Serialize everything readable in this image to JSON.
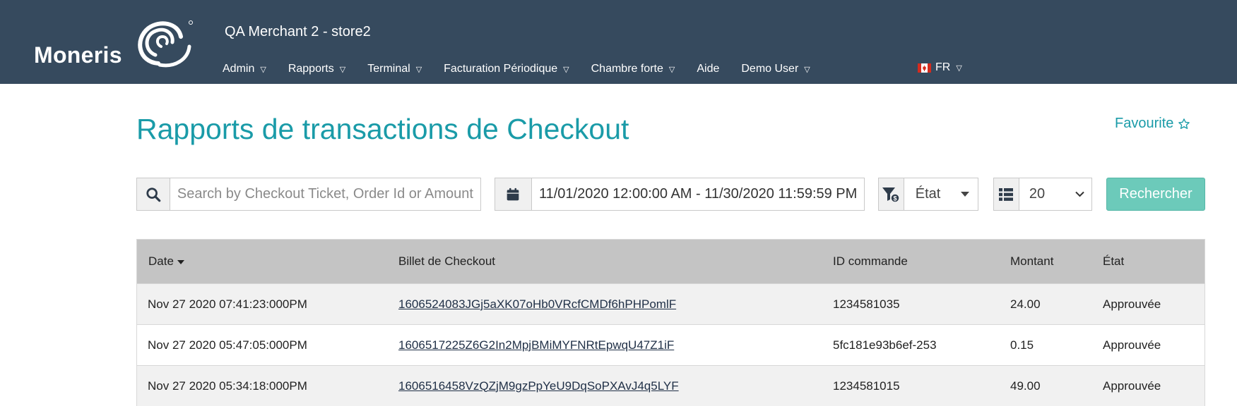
{
  "header": {
    "logo_text": "Moneris",
    "merchant": "QA Merchant 2 - store2",
    "nav": [
      {
        "label": "Admin",
        "has_dropdown": true
      },
      {
        "label": "Rapports",
        "has_dropdown": true
      },
      {
        "label": "Terminal",
        "has_dropdown": true
      },
      {
        "label": "Facturation Périodique",
        "has_dropdown": true
      },
      {
        "label": "Chambre forte",
        "has_dropdown": true
      },
      {
        "label": "Aide",
        "has_dropdown": false
      },
      {
        "label": "Demo User",
        "has_dropdown": true
      }
    ],
    "language": "FR",
    "colors": {
      "bar": "#364a5e",
      "accent": "#1a9ba8",
      "button": "#6ccaba"
    }
  },
  "page": {
    "title": "Rapports de transactions de Checkout",
    "favourite_label": "Favourite"
  },
  "toolbar": {
    "search_placeholder": "Search by Checkout Ticket, Order Id or Amount",
    "search_value": "",
    "date_range": "11/01/2020 12:00:00 AM - 11/30/2020 11:59:59 PM",
    "status_filter_label": "État",
    "page_size": "20",
    "search_button": "Rechercher"
  },
  "table": {
    "columns": [
      "Date",
      "Billet de Checkout",
      "ID commande",
      "Montant",
      "État"
    ],
    "sorted_column": "Date",
    "sort_direction": "descending",
    "rows": [
      {
        "date": "Nov 27 2020 07:41:23:000PM",
        "ticket": "1606524083JGj5aXK07oHb0VRcfCMDf6hPHPomlF",
        "order_id": "1234581035",
        "amount": "24.00",
        "status": "Approuvée"
      },
      {
        "date": "Nov 27 2020 05:47:05:000PM",
        "ticket": "1606517225Z6G2In2MpjBMiMYFNRtEpwqU47Z1iF",
        "order_id": "5fc181e93b6ef-253",
        "amount": "0.15",
        "status": "Approuvée"
      },
      {
        "date": "Nov 27 2020 05:34:18:000PM",
        "ticket": "1606516458VzQZjM9gzPpYeU9DqSoPXAvJ4q5LYF",
        "order_id": "1234581015",
        "amount": "49.00",
        "status": "Approuvée"
      }
    ]
  }
}
